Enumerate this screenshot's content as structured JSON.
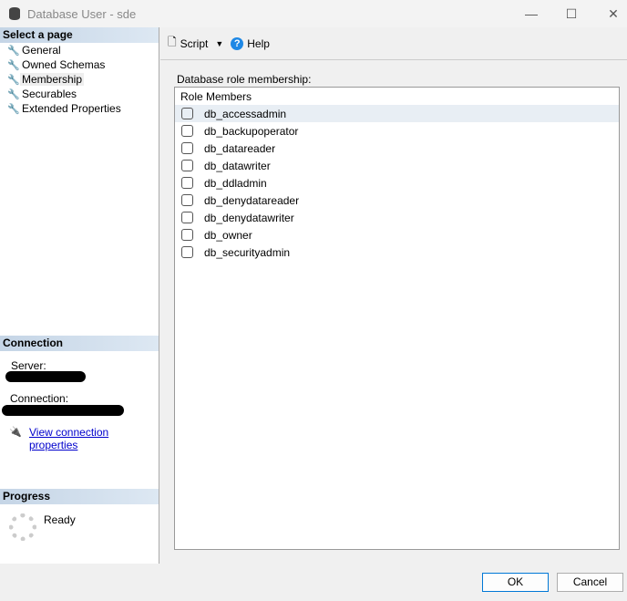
{
  "window": {
    "title": "Database User - sde",
    "minimize": "—",
    "maximize": "☐",
    "close": "✕"
  },
  "sidebar": {
    "select_header": "Select a page",
    "items": [
      {
        "label": "General"
      },
      {
        "label": "Owned Schemas"
      },
      {
        "label": "Membership"
      },
      {
        "label": "Securables"
      },
      {
        "label": "Extended Properties"
      }
    ],
    "connection_header": "Connection",
    "server_label": "Server:",
    "connection_label": "Connection:",
    "view_link": "View connection properties",
    "progress_header": "Progress",
    "progress_status": "Ready"
  },
  "toolbar": {
    "script": "Script",
    "help": "Help"
  },
  "main": {
    "section_label": "Database role membership:",
    "column_header": "Role Members",
    "roles": [
      {
        "name": "db_accessadmin",
        "checked": false
      },
      {
        "name": "db_backupoperator",
        "checked": false
      },
      {
        "name": "db_datareader",
        "checked": false
      },
      {
        "name": "db_datawriter",
        "checked": false
      },
      {
        "name": "db_ddladmin",
        "checked": false
      },
      {
        "name": "db_denydatareader",
        "checked": false
      },
      {
        "name": "db_denydatawriter",
        "checked": false
      },
      {
        "name": "db_owner",
        "checked": false
      },
      {
        "name": "db_securityadmin",
        "checked": false
      }
    ]
  },
  "buttons": {
    "ok": "OK",
    "cancel": "Cancel"
  }
}
